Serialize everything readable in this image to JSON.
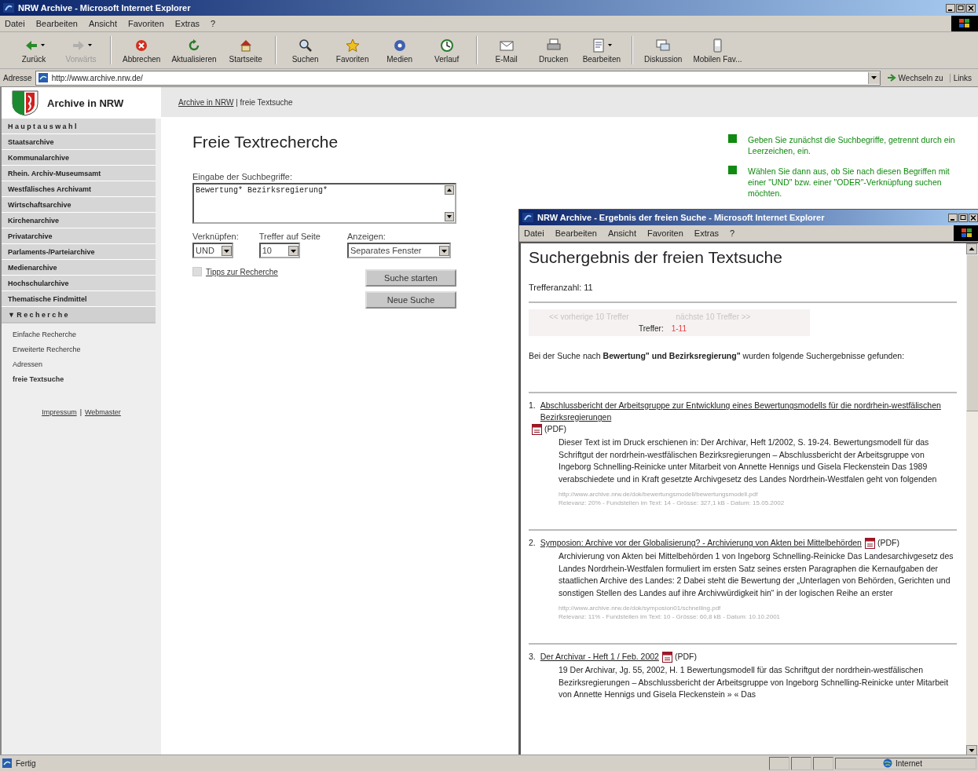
{
  "window": {
    "title": "NRW Archive - Microsoft Internet Explorer"
  },
  "menu": [
    "Datei",
    "Bearbeiten",
    "Ansicht",
    "Favoriten",
    "Extras",
    "?"
  ],
  "toolbar": [
    {
      "label": "Zurück",
      "disabled": false,
      "dropdown": true
    },
    {
      "label": "Vorwärts",
      "disabled": true,
      "dropdown": true
    },
    {
      "label": "Abbrechen",
      "disabled": false,
      "dropdown": false
    },
    {
      "label": "Aktualisieren",
      "disabled": false,
      "dropdown": false
    },
    {
      "label": "Startseite",
      "disabled": false,
      "dropdown": false
    },
    {
      "label": "Suchen",
      "disabled": false,
      "dropdown": false
    },
    {
      "label": "Favoriten",
      "disabled": false,
      "dropdown": false
    },
    {
      "label": "Medien",
      "disabled": false,
      "dropdown": false
    },
    {
      "label": "Verlauf",
      "disabled": false,
      "dropdown": false
    },
    {
      "label": "E-Mail",
      "disabled": false,
      "dropdown": false
    },
    {
      "label": "Drucken",
      "disabled": false,
      "dropdown": false
    },
    {
      "label": "Bearbeiten",
      "disabled": false,
      "dropdown": true
    },
    {
      "label": "Diskussion",
      "disabled": false,
      "dropdown": false
    },
    {
      "label": "Mobilen Fav...",
      "disabled": false,
      "dropdown": false
    }
  ],
  "address": {
    "label": "Adresse",
    "value": "http://www.archive.nrw.de/",
    "go": "Wechseln zu",
    "links": "Links"
  },
  "site": {
    "logo_text": "Archive in NRW",
    "breadcrumb": [
      {
        "text": "Archive in NRW",
        "link": true
      },
      {
        "text": " | ",
        "link": false
      },
      {
        "text": "freie Textsuche",
        "link": false
      }
    ]
  },
  "sidebar": {
    "items": [
      {
        "label": "Hauptauswahl",
        "kind": "heading"
      },
      {
        "label": "Staatsarchive",
        "kind": "item"
      },
      {
        "label": "Kommunalarchive",
        "kind": "item"
      },
      {
        "label": "Rhein. Archiv-Museumsamt",
        "kind": "item"
      },
      {
        "label": "Westfälisches Archivamt",
        "kind": "item"
      },
      {
        "label": "Wirtschaftsarchive",
        "kind": "item"
      },
      {
        "label": "Kirchenarchive",
        "kind": "item"
      },
      {
        "label": "Privatarchive",
        "kind": "item"
      },
      {
        "label": "Parlaments-/Parteiarchive",
        "kind": "item"
      },
      {
        "label": "Medienarchive",
        "kind": "item"
      },
      {
        "label": "Hochschularchive",
        "kind": "item"
      },
      {
        "label": "Thematische Findmittel",
        "kind": "item"
      },
      {
        "label": "▼Recherche",
        "kind": "heading",
        "expanded": true,
        "children": [
          {
            "label": "Einfache Recherche",
            "selected": false
          },
          {
            "label": "Erweiterte Recherche",
            "selected": false
          },
          {
            "label": "Adressen",
            "selected": false
          },
          {
            "label": "freie Textsuche",
            "selected": true
          }
        ]
      }
    ],
    "footer_links": [
      "Impressum",
      "Webmaster"
    ],
    "footer_separator": "|"
  },
  "form": {
    "title": "Freie Textrecherche",
    "terms_label": "Eingabe der Suchbegriffe:",
    "terms_value": "Bewertung* Bezirksregierung*",
    "selects": [
      {
        "label": "Verknüpfen:",
        "value": "UND"
      },
      {
        "label": "Treffer auf Seite",
        "value": "10"
      },
      {
        "label": "Anzeigen:",
        "value": "Separates Fenster"
      }
    ],
    "tips": {
      "label": "Tipps zur Recherche",
      "checked": false
    },
    "buttons": [
      "Suche starten",
      "Neue Suche"
    ]
  },
  "hints": [
    {
      "text": "Geben Sie zunächst die Suchbegriffe, getrennt durch ein Leerzeichen, ein.",
      "color": "#108a10"
    },
    {
      "text": "Wählen Sie dann aus, ob Sie nach diesen Begriffen mit einer \"UND\" bzw. einer \"ODER\"-Verknüpfung suchen möchten.",
      "color": "#108a10"
    }
  ],
  "popup": {
    "title": "NRW Archive - Ergebnis der freien Suche - Microsoft Internet Explorer",
    "menu": [
      "Datei",
      "Bearbeiten",
      "Ansicht",
      "Favoriten",
      "Extras",
      "?"
    ],
    "heading": "Suchergebnis der freien Textsuche",
    "count": "Trefferanzahl: 11",
    "pager": {
      "previous": "<< vorherige 10 Treffer",
      "next": "nächste 10 Treffer >>",
      "label": "Treffer:",
      "range": "1-11"
    },
    "intro": "Bei der Suche nach **Bewertung\" und Bezirksregierung\"** wurden folgende Suchergebnisse gefunden:",
    "results": [
      {
        "number": "1.",
        "title": "Abschlussbericht der Arbeitsgruppe zur Entwicklung eines Bewertungsmodells für die nordrhein-westfälischen Bezirksregierungen",
        "format": "(PDF)",
        "snippet": "Dieser Text ist im Druck erschienen in: Der Archivar, Heft 1/2002, S. 19-24. Bewertungsmodell für das Schriftgut der nordrhein-westfälischen Bezirksregierungen – Abschlussbericht der Arbeitsgruppe von Ingeborg Schnelling-Reinicke unter Mitarbeit von Annette Hennigs und Gisela Fleckenstein Das 1989 verabschiedete und in Kraft gesetzte Archivgesetz des Landes Nordrhein-Westfalen geht von folgenden",
        "url": "http://www.archive.nrw.de/dok/bewertungsmodell/bewertungsmodell.pdf",
        "meta": "Relevanz: 20% - Fundstellen im Text: 14 - Grösse: 327,1 kB - Datum: 15.05.2002"
      },
      {
        "number": "2.",
        "title": "Symposion: Archive vor der Globalisierung? - Archivierung von Akten bei Mittelbehörden",
        "format": "(PDF)",
        "snippet": "Archivierung von Akten bei Mittelbehörden 1 von Ingeborg Schnelling-Reinicke Das Landesarchivgesetz des Landes Nordrhein-Westfalen formuliert im ersten Satz seines ersten Paragraphen die Kernaufgaben der staatlichen Archive des Landes: 2 Dabei steht die Bewertung der „Unterlagen von Behörden, Gerichten und sonstigen Stellen des Landes auf ihre Archivwürdigkeit hin“ in der logischen Reihe an erster",
        "url": "http://www.archive.nrw.de/dok/symposion01/schnelling.pdf",
        "meta": "Relevanz: 11% - Fundstellen im Text: 10 - Grösse: 60,8 kB - Datum: 10.10.2001"
      },
      {
        "number": "3.",
        "title": "Der Archivar - Heft 1 / Feb. 2002",
        "format": "(PDF)",
        "snippet": "19 Der Archivar, Jg. 55, 2002, H. 1 Bewertungsmodell für das Schriftgut der nordrhein-westfälischen Bezirksregierungen – Abschlussbericht der Arbeitsgruppe von Ingeborg Schnelling-Reinicke unter Mitarbeit von Annette Hennigs und Gisela Fleckenstein » « Das"
      }
    ]
  },
  "status_bar": {
    "text": "Fertig",
    "zone": "Internet"
  }
}
